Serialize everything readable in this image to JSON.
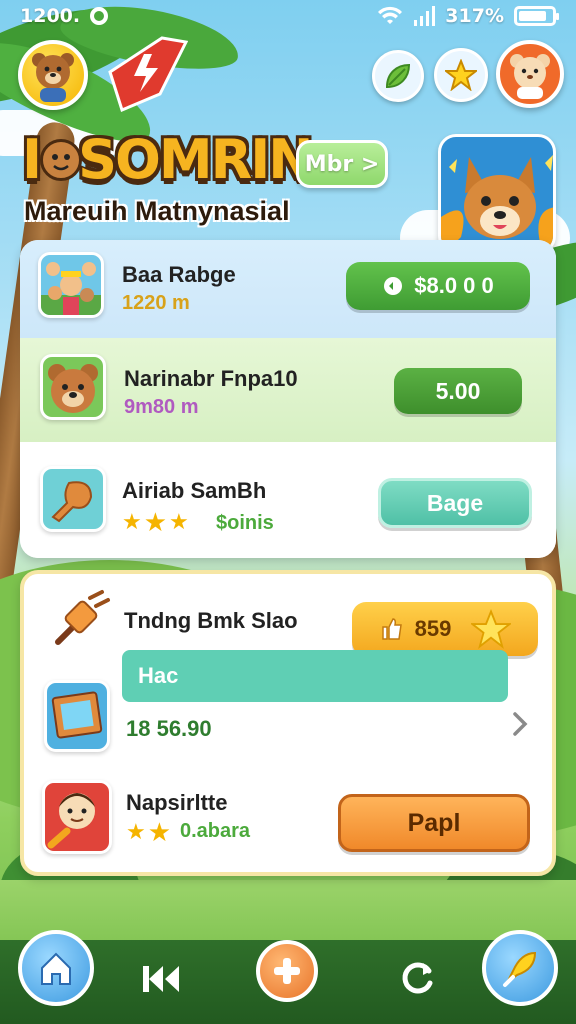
{
  "status_bar": {
    "time": "1200.",
    "battery": "317%",
    "battery_level": 0.85
  },
  "header": {
    "title": "SOMRIN",
    "subtitle": "Mareuih Matnynasial",
    "mbr_button": "Mbr >"
  },
  "panel_top": [
    {
      "name": "Baa Rabge",
      "detail": "1220  m",
      "action": "$8.0 0 0",
      "action_color": "#4caa3c",
      "detail_color": "#d8a21a"
    },
    {
      "name": "Narinabr Fnpa10",
      "detail": "9m80  m",
      "action": "5.00",
      "action_color": "#4a9a32",
      "detail_color": "#b05ac0"
    },
    {
      "name": "Airiab SamBh",
      "detail": "$oinis",
      "action": "Bage",
      "action_color": "#5fcfb4",
      "detail_color": "#4caa3c",
      "rating": 3
    }
  ],
  "panel_bottom": [
    {
      "name": "Tndng Bmk Slao",
      "action": "859",
      "action_color": "#f6b420"
    },
    {
      "name": "Hac",
      "detail": "18 56.90",
      "detail_color": "#2f7d2f"
    },
    {
      "name": "Napsirltte",
      "detail": "0.abara",
      "action": "Papl",
      "action_color": "#f39a3e",
      "detail_color": "#4caa3c",
      "rating": 2
    }
  ],
  "icons": {
    "status": [
      "ring-icon",
      "wifi-icon",
      "signal-icon",
      "battery-icon"
    ],
    "top": [
      "bear-avatar-icon",
      "bolt-icon",
      "leaf-icon",
      "star-icon",
      "bear-profile-icon"
    ],
    "nav": [
      "home-icon",
      "rewind-icon",
      "plus-icon",
      "refresh-icon",
      "leaf-pen-icon"
    ]
  },
  "colors": {
    "accent": "#4caa3c",
    "gold": "#f6b420",
    "teal": "#5fcfb4",
    "orange": "#f39a3e"
  }
}
